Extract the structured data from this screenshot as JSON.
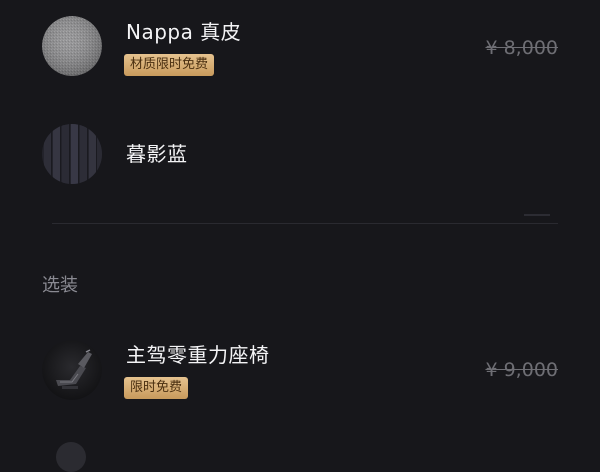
{
  "options": [
    {
      "title": "Nappa 真皮",
      "badge": "材质限时免费",
      "price": "¥ 8,000",
      "thumb_icon": "grey-leather-swatch"
    },
    {
      "title": "暮影蓝",
      "thumb_icon": "dark-blue-striped-swatch"
    }
  ],
  "optional_section": {
    "label": "选装",
    "items": [
      {
        "title": "主驾零重力座椅",
        "badge": "限时免费",
        "price": "¥ 9,000",
        "thumb_icon": "reclined-seat-photo"
      }
    ]
  },
  "colors": {
    "background": "#17171b",
    "badge_gold": "#d9b27a",
    "strikethrough_price": "#6e6e74"
  }
}
